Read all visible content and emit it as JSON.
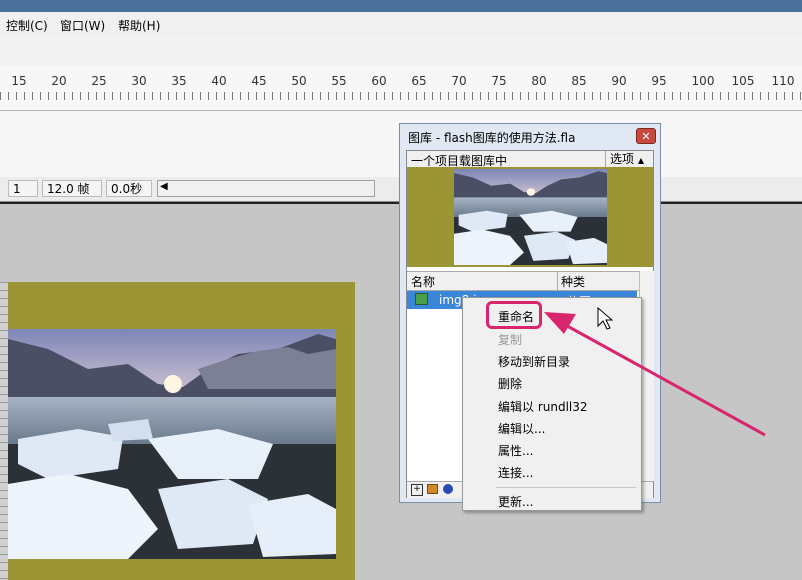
{
  "menubar": {
    "items": [
      "控制(C)",
      "窗口(W)",
      "帮助(H)"
    ]
  },
  "ruler": {
    "numbers": [
      "15",
      "20",
      "25",
      "30",
      "35",
      "40",
      "45",
      "50",
      "55",
      "60",
      "65",
      "70",
      "75",
      "80",
      "85",
      "90",
      "95",
      "100",
      "105",
      "110"
    ]
  },
  "statusbar": {
    "frame": "1",
    "fps": "12.0 帧",
    "time": "0.0秒",
    "scroll_arrow": "◀"
  },
  "library": {
    "title": "图库 - flash图库的使用方法.fla",
    "close": "✕",
    "info": "一个项目载图库中",
    "options": "选项",
    "columns": {
      "name": "名称",
      "kind": "种类"
    },
    "item": {
      "name": "img8.jpg",
      "kind": "位图"
    }
  },
  "context_menu": {
    "items": [
      {
        "label": "重命名",
        "enabled": true
      },
      {
        "label": "复制",
        "enabled": false
      },
      {
        "label": "移动到新目录",
        "enabled": true
      },
      {
        "label": "删除",
        "enabled": true
      },
      {
        "label": "编辑以 rundll32",
        "enabled": true
      },
      {
        "label": "编辑以...",
        "enabled": true
      },
      {
        "label": "属性...",
        "enabled": true
      },
      {
        "label": "连接...",
        "enabled": true
      },
      {
        "label": "更新...",
        "enabled": true
      }
    ]
  },
  "colors": {
    "olive": "#9b9536",
    "selection": "#3a86d8",
    "annotation": "#d9246e"
  }
}
